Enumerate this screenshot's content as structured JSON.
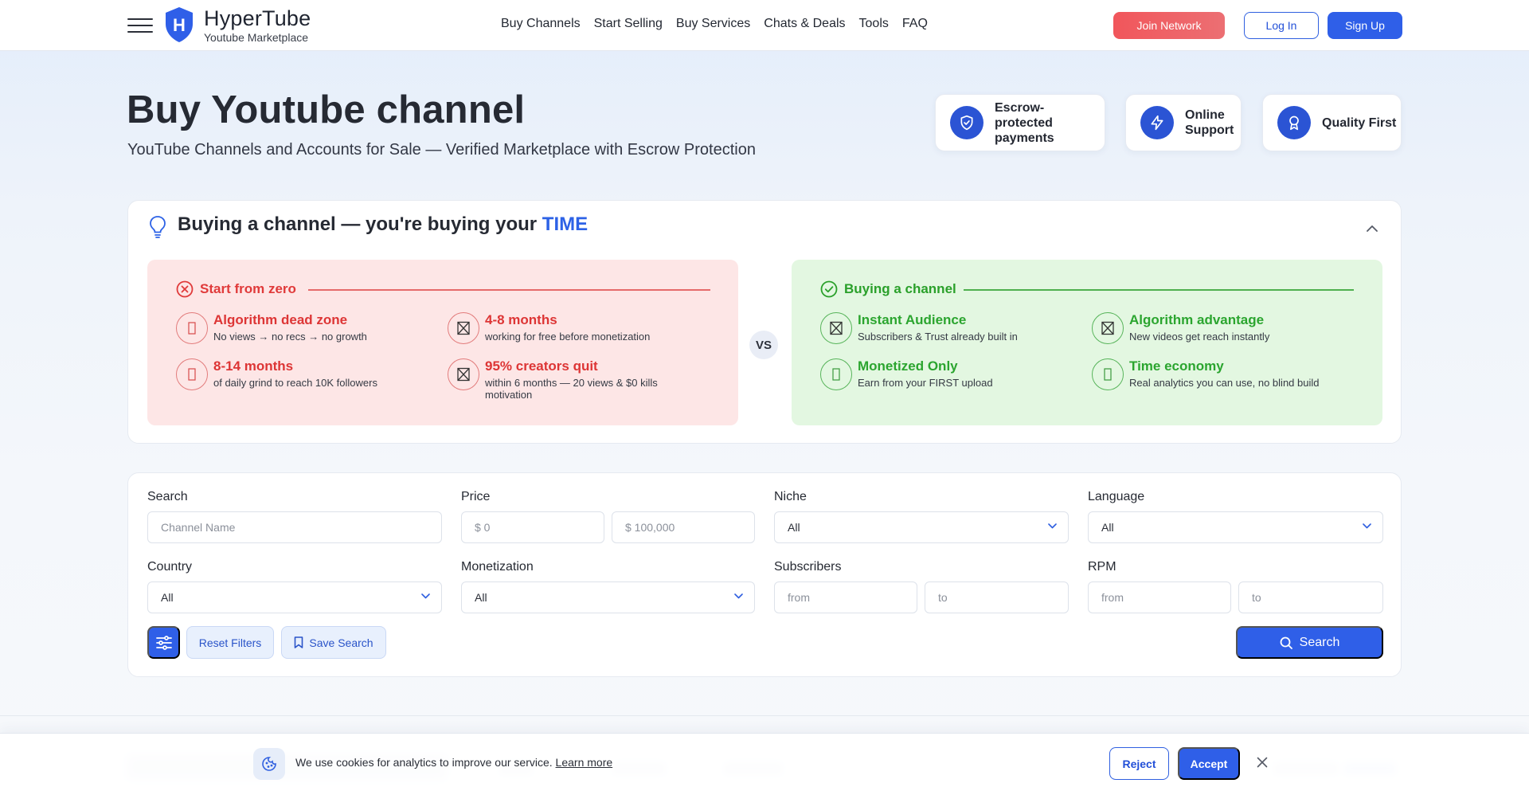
{
  "header": {
    "brand_name": "HyperTube",
    "brand_sub": "Youtube Marketplace",
    "logo_letter": "H",
    "nav": [
      "Buy Channels",
      "Start Selling",
      "Buy Services",
      "Chats & Deals",
      "Tools",
      "FAQ"
    ],
    "join_label": "Join Network",
    "login_label": "Log In",
    "signup_label": "Sign Up"
  },
  "hero": {
    "title": "Buy Youtube channel",
    "subtitle": "YouTube Channels and Accounts for Sale — Verified Marketplace with Escrow Protection",
    "features": [
      {
        "label": "Escrow-protected payments",
        "icon": "shield-check-icon"
      },
      {
        "label": "Online Support",
        "icon": "lightning-icon"
      },
      {
        "label": "Quality First",
        "icon": "award-icon"
      }
    ]
  },
  "time_panel": {
    "title_prefix": "Buying a channel — you're buying your",
    "title_accent": "TIME",
    "vs_label": "VS",
    "left": {
      "heading": "Start from zero",
      "items": [
        {
          "title": "Algorithm dead zone",
          "desc": "No views → no recs → no growth"
        },
        {
          "title": "4-8 months",
          "desc": "working for free before monetization"
        },
        {
          "title": "8-14 months",
          "desc": "of daily grind to reach 10K followers"
        },
        {
          "title": "95% creators quit",
          "desc": "within 6 months — 20 views & $0 kills motivation"
        }
      ]
    },
    "right": {
      "heading": "Buying a channel",
      "items": [
        {
          "title": "Instant Audience",
          "desc": "Subscribers & Trust already built in"
        },
        {
          "title": "Algorithm advantage",
          "desc": "New videos get reach instantly"
        },
        {
          "title": "Monetized Only",
          "desc": "Earn from your FIRST upload"
        },
        {
          "title": "Time economy",
          "desc": "Real analytics you can use, no blind build"
        }
      ]
    }
  },
  "filters": {
    "search_label": "Search",
    "search_placeholder": "Channel Name",
    "price_label": "Price",
    "price_from_placeholder": "$ 0",
    "price_to_placeholder": "$ 100,000",
    "niche_label": "Niche",
    "niche_value": "All",
    "language_label": "Language",
    "language_value": "All",
    "country_label": "Country",
    "country_value": "All",
    "monetization_label": "Monetization",
    "monetization_value": "All",
    "subscribers_label": "Subscribers",
    "subscribers_from_placeholder": "from",
    "subscribers_to_placeholder": "to",
    "rpm_label": "RPM",
    "rpm_from_placeholder": "from",
    "rpm_to_placeholder": "to",
    "reset_label": "Reset Filters",
    "save_label": "Save Search",
    "search_button_label": "Search"
  },
  "cookie": {
    "text": "We use cookies for analytics to improve our service.",
    "link": "Learn more",
    "reject_label": "Reject",
    "accept_label": "Accept"
  },
  "colors": {
    "primary": "#2f5fe8",
    "join": "#f1565b",
    "negative": "#dd3535",
    "positive": "#2ba52f"
  }
}
